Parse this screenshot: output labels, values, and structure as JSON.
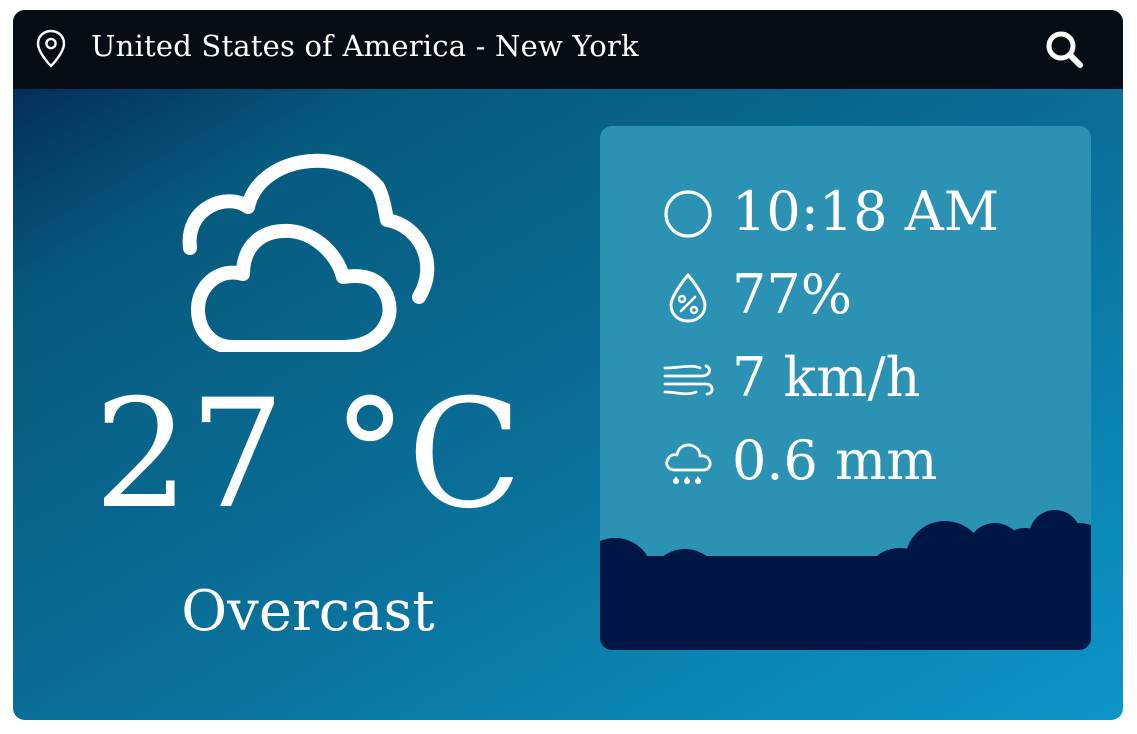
{
  "header": {
    "location": "United States of America - New York",
    "pin_icon": "map-pin-icon",
    "search_icon": "search-icon"
  },
  "current": {
    "icon": "cloudy-icon",
    "temperature": "27 °C",
    "condition": "Overcast"
  },
  "details": [
    {
      "icon": "clock-circle-icon",
      "value": "10:18 AM"
    },
    {
      "icon": "humidity-drop-icon",
      "value": "77%"
    },
    {
      "icon": "wind-icon",
      "value": "7 km/h"
    },
    {
      "icon": "rain-cloud-icon",
      "value": "0.6 mm"
    }
  ],
  "colors": {
    "topbar": "#060d14",
    "panel": "#2b92b4",
    "clouds": "#001745",
    "gradient_start": "#041e4e",
    "gradient_end": "#0d96c8"
  }
}
